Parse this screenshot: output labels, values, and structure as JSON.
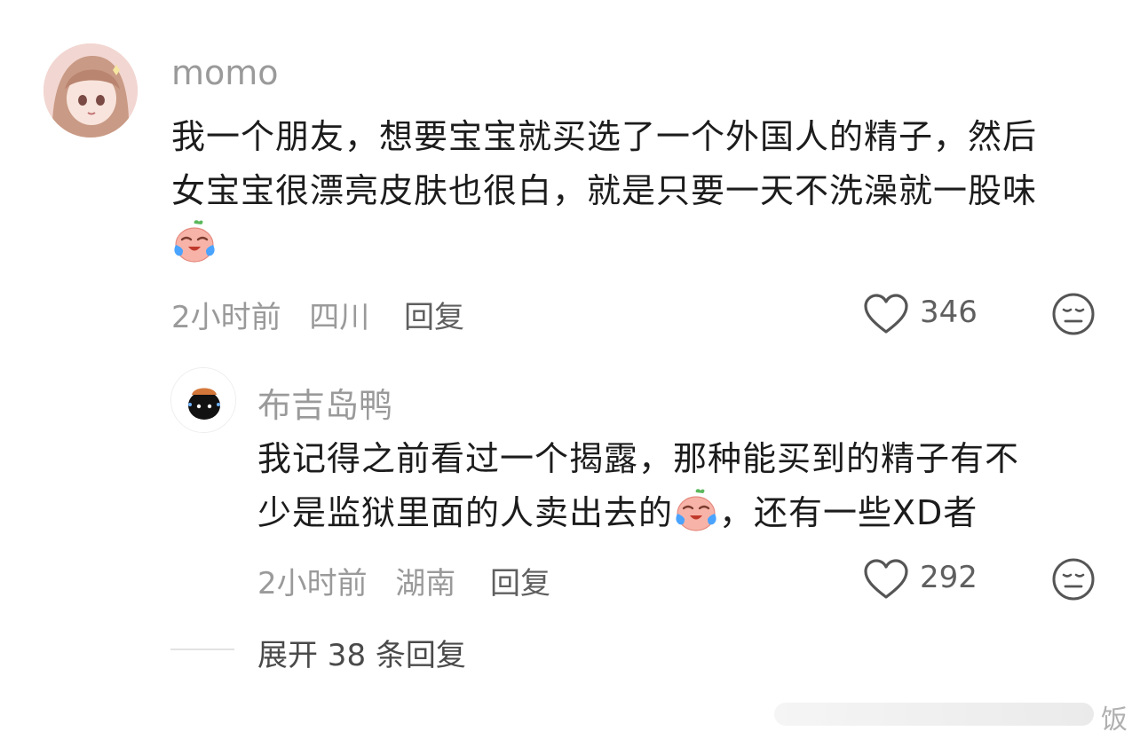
{
  "comment": {
    "username": "momo",
    "text_line1": "我一个朋友，想要宝宝就买选了一个外国人的精子，然后",
    "text_line2": "女宝宝很漂亮皮肤也很白，就是只要一天不洗澡就一股味",
    "emoji": "crying-laughing-peach-emoji",
    "time": "2小时前",
    "location": "四川",
    "reply_label": "回复",
    "like_count": "346"
  },
  "reply": {
    "username": "布吉岛鸭",
    "text_line1": "我记得之前看过一个揭露，那种能买到的精子有不",
    "text_line2_before": "少是监狱里面的人卖出去的",
    "text_line2_after": "，还有一些XD者",
    "emoji": "crying-laughing-peach-emoji",
    "time": "2小时前",
    "location": "湖南",
    "reply_label": "回复",
    "like_count": "292"
  },
  "expand": {
    "label": "展开 38 条回复"
  },
  "watermark": {
    "text": "饭"
  },
  "colors": {
    "username": "#9a9a9a",
    "meta": "#9a9a9a",
    "text": "#1c1c1c"
  }
}
